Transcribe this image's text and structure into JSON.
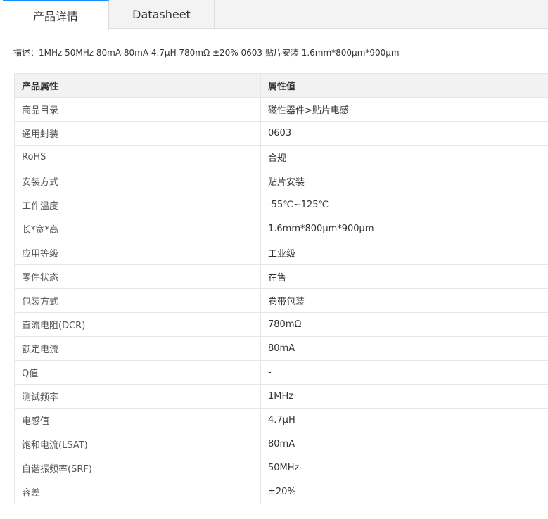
{
  "tabs": [
    {
      "label": "产品详情",
      "active": true
    },
    {
      "label": "Datasheet",
      "active": false
    }
  ],
  "description": "描述：1MHz 50MHz 80mA 80mA 4.7μH 780mΩ ±20% 0603 贴片安装 1.6mm*800μm*900μm",
  "table": {
    "headers": [
      "产品属性",
      "属性值"
    ],
    "rows": [
      {
        "key": "商品目录",
        "value": "磁性器件>贴片电感"
      },
      {
        "key": "通用封装",
        "value": "0603"
      },
      {
        "key": "RoHS",
        "value": "合规"
      },
      {
        "key": "安装方式",
        "value": "贴片安装"
      },
      {
        "key": "工作温度",
        "value": "-55℃~125℃"
      },
      {
        "key": "长*宽*高",
        "value": "1.6mm*800μm*900μm"
      },
      {
        "key": "应用等级",
        "value": "工业级"
      },
      {
        "key": "零件状态",
        "value": "在售"
      },
      {
        "key": "包装方式",
        "value": "卷带包装"
      },
      {
        "key": "直流电阻(DCR)",
        "value": "780mΩ"
      },
      {
        "key": "额定电流",
        "value": "80mA"
      },
      {
        "key": "Q值",
        "value": "-"
      },
      {
        "key": "测试频率",
        "value": "1MHz"
      },
      {
        "key": "电感值",
        "value": "4.7μH"
      },
      {
        "key": "饱和电流(LSAT)",
        "value": "80mA"
      },
      {
        "key": "自谐振频率(SRF)",
        "value": "50MHz"
      },
      {
        "key": "容差",
        "value": "±20%"
      }
    ]
  },
  "colors": {
    "accent": "#1890ff",
    "header_bg": "#f2f2f2",
    "border": "#e6e6e6"
  }
}
